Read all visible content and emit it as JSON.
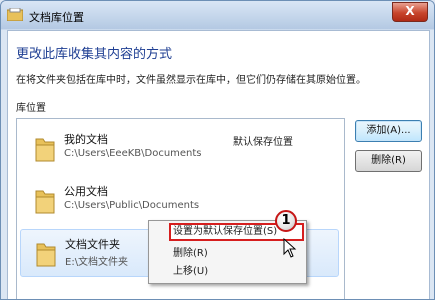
{
  "window": {
    "title": "文档库位置",
    "close_label": "X"
  },
  "heading": "更改此库收集其内容的方式",
  "description": "在将文件夹包括在库中时，文件虽然显示在库中，但它们仍存储在其原始位置。",
  "locations_label": "库位置",
  "locations": [
    {
      "name": "我的文档",
      "path": "C:\\Users\\EeeKB\\Documents",
      "tag": "默认保存位置"
    },
    {
      "name": "公用文档",
      "path": "C:\\Users\\Public\\Documents",
      "tag": ""
    },
    {
      "name": "文档文件夹",
      "path": "E:\\文档文件夹",
      "tag": ""
    }
  ],
  "buttons": {
    "add": "添加(A)...",
    "remove": "删除(R)"
  },
  "context_menu": {
    "items": [
      "设置为默认保存位置(S)",
      "删除(R)",
      "上移(U)"
    ]
  },
  "callout_number": "1",
  "colors": {
    "heading": "#1f3f93",
    "highlight_border": "#d61e1e",
    "folder": "#e8c15a"
  }
}
